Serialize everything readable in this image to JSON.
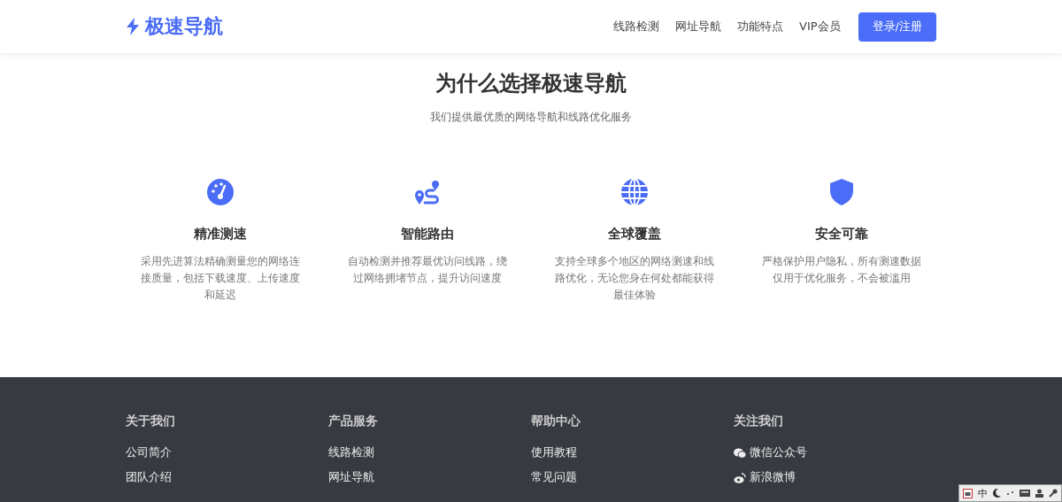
{
  "header": {
    "logo": "极速导航",
    "nav": [
      "线路检测",
      "网址导航",
      "功能特点",
      "VIP会员"
    ],
    "login_button": "登录/注册"
  },
  "section": {
    "title": "为什么选择极速导航",
    "subtitle": "我们提供最优质的网络导航和线路优化服务",
    "features": [
      {
        "kind": "speed",
        "title": "精准测速",
        "text": "采用先进算法精确测量您的网络连接质量，包括下载速度、上传速度和延迟"
      },
      {
        "kind": "route",
        "title": "智能路由",
        "text": "自动检测并推荐最优访问线路，绕过网络拥堵节点，提升访问速度"
      },
      {
        "kind": "globe",
        "title": "全球覆盖",
        "text": "支持全球多个地区的网络测速和线路优化，无论您身在何处都能获得最佳体验"
      },
      {
        "kind": "shield",
        "title": "安全可靠",
        "text": "严格保护用户隐私，所有测速数据仅用于优化服务，不会被滥用"
      }
    ]
  },
  "footer": {
    "columns": [
      {
        "title": "关于我们",
        "links": [
          {
            "label": "公司简介"
          },
          {
            "label": "团队介绍"
          }
        ]
      },
      {
        "title": "产品服务",
        "links": [
          {
            "label": "线路检测"
          },
          {
            "label": "网址导航"
          }
        ]
      },
      {
        "title": "帮助中心",
        "links": [
          {
            "label": "使用教程"
          },
          {
            "label": "常见问题"
          }
        ]
      },
      {
        "title": "关注我们",
        "links": [
          {
            "label": "微信公众号",
            "kind": "wechat"
          },
          {
            "label": "新浪微博",
            "kind": "weibo"
          }
        ]
      }
    ]
  },
  "ime_bar": {
    "label": "中"
  }
}
